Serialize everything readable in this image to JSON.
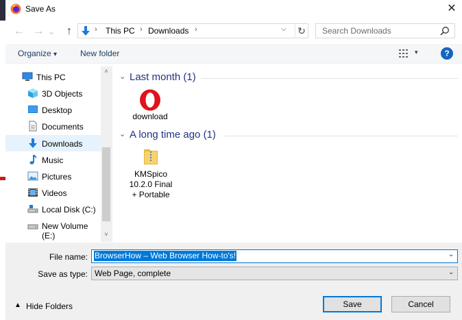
{
  "window": {
    "title": "Save As",
    "close_glyph": "✕"
  },
  "nav": {
    "back_glyph": "←",
    "forward_glyph": "→",
    "recent_glyph": "⌄",
    "up_glyph": "↑",
    "breadcrumb": [
      "This PC",
      "Downloads"
    ],
    "separator": "›",
    "refresh_glyph": "↻",
    "dropdown_glyph": "⌵",
    "search_placeholder": "Search Downloads"
  },
  "toolbar": {
    "organize": "Organize",
    "organize_caret": "▾",
    "new_folder": "New folder",
    "view_caret": "▾",
    "help": "?"
  },
  "sidebar": {
    "items": [
      {
        "label": "This PC",
        "icon": "monitor-icon"
      },
      {
        "label": "3D Objects",
        "icon": "cube-icon"
      },
      {
        "label": "Desktop",
        "icon": "desktop-icon"
      },
      {
        "label": "Documents",
        "icon": "document-icon"
      },
      {
        "label": "Downloads",
        "icon": "download-arrow-icon",
        "selected": true
      },
      {
        "label": "Music",
        "icon": "music-note-icon"
      },
      {
        "label": "Pictures",
        "icon": "picture-icon"
      },
      {
        "label": "Videos",
        "icon": "film-icon"
      },
      {
        "label": "Local Disk (C:)",
        "icon": "drive-icon"
      },
      {
        "label": "New Volume (E:)",
        "icon": "drive-icon"
      }
    ],
    "scroll_up_glyph": "˄",
    "scroll_down_glyph": "˅"
  },
  "groups": [
    {
      "header": "Last month (1)",
      "files": [
        {
          "label_lines": [
            "download"
          ],
          "icon": "opera-icon"
        }
      ]
    },
    {
      "header": "A long time ago (1)",
      "files": [
        {
          "label_lines": [
            "KMSpico",
            "10.2.0 Final",
            "+ Portable"
          ],
          "icon": "zip-folder-icon"
        }
      ]
    }
  ],
  "group_chevron": "⌄",
  "bottom": {
    "file_name_label": "File name:",
    "file_name_value": "BrowserHow – Web Browser How-to's!",
    "save_type_label": "Save as type:",
    "save_type_value": "Web Page, complete",
    "dropdown_glyph": "⌄",
    "hide_folders": "Hide Folders",
    "hide_arrow": "▲",
    "save": "Save",
    "cancel": "Cancel"
  },
  "colors": {
    "accent": "#0078d7",
    "link": "#1e3287",
    "help": "#1565c0",
    "selected_row": "#e5f3ff"
  }
}
